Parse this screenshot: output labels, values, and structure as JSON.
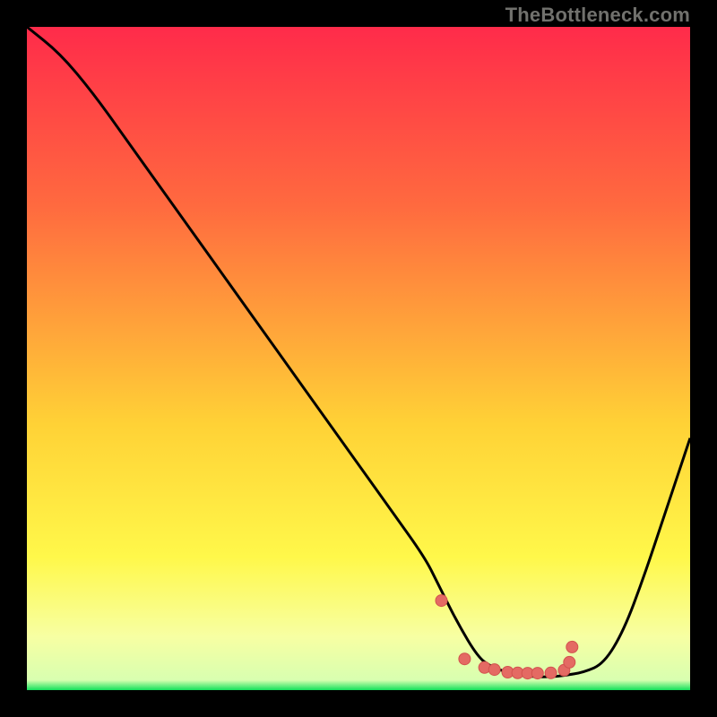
{
  "watermark": "TheBottleneck.com",
  "colors": {
    "background": "#000000",
    "grad_top": "#ff2b4a",
    "grad_mid1": "#ff6a3f",
    "grad_mid2": "#ffd236",
    "grad_low": "#fff84a",
    "grad_pale": "#f7ffa3",
    "grad_bottom": "#13e05b",
    "curve": "#000000",
    "marker_fill": "#e46a63",
    "marker_stroke": "#d2524e"
  },
  "chart_data": {
    "type": "line",
    "title": "",
    "xlabel": "",
    "ylabel": "",
    "xlim": [
      0,
      100
    ],
    "ylim": [
      0,
      100
    ],
    "series": [
      {
        "name": "bottleneck-curve",
        "x": [
          0,
          5,
          10,
          15,
          20,
          25,
          30,
          35,
          40,
          45,
          50,
          55,
          60,
          62,
          65,
          68,
          70,
          73,
          76,
          79,
          81,
          84,
          87,
          90,
          93,
          96,
          100
        ],
        "y": [
          100,
          96,
          90,
          83,
          76,
          69,
          62,
          55,
          48,
          41,
          34,
          27,
          20,
          16,
          10,
          5,
          3.5,
          2.5,
          2,
          2,
          2.2,
          2.7,
          4,
          9,
          17,
          26,
          38
        ]
      }
    ],
    "markers": {
      "name": "highlight-dots",
      "x": [
        62.5,
        66,
        69,
        70.5,
        72.5,
        74,
        75.5,
        77,
        79,
        81,
        81.8,
        82.2
      ],
      "y": [
        13.5,
        4.7,
        3.4,
        3.1,
        2.7,
        2.6,
        2.55,
        2.55,
        2.6,
        3.0,
        4.2,
        6.5
      ]
    }
  }
}
